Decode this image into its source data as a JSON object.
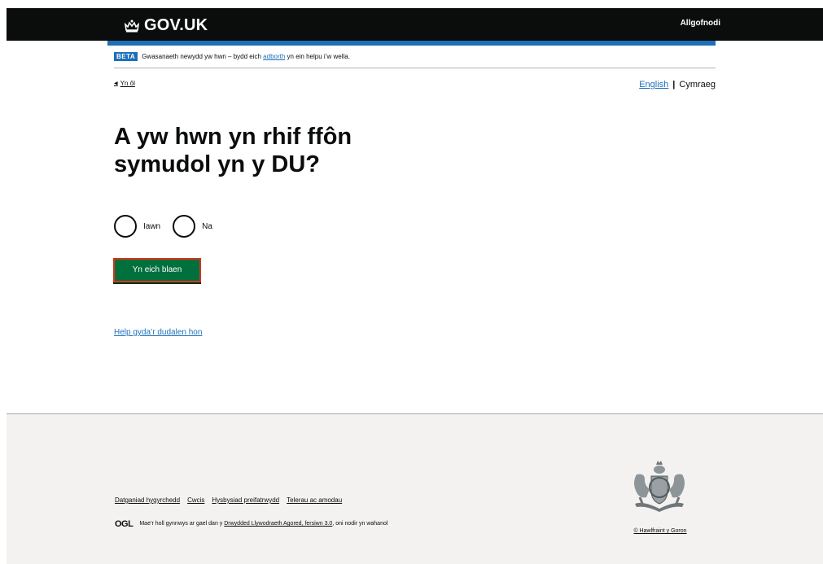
{
  "header": {
    "logo_text": "GOV.UK",
    "signout_label": "Allgofnodi"
  },
  "phase_banner": {
    "tag": "BETA",
    "text_before": "Gwasanaeth newydd yw hwn – bydd eich ",
    "link": "adborth",
    "text_after": " yn ein helpu i’w wella."
  },
  "back_link": "Yn ôl",
  "language": {
    "english": "English",
    "separator": "|",
    "current": "Cymraeg"
  },
  "question": "A yw hwn yn rhif ffôn symudol yn y DU?",
  "radios": [
    {
      "label": "Iawn"
    },
    {
      "label": "Na"
    }
  ],
  "continue_button": "Yn eich blaen",
  "help_link": "Help gyda’r dudalen hon",
  "footer": {
    "links": [
      "Datganiad hygyrchedd",
      "Cwcis",
      "Hysbysiad preifatrwydd",
      "Telerau ac amodau"
    ],
    "ogl_logo": "OGL",
    "ogl_before": "Mae’r holl gynnwys ar gael dan y ",
    "ogl_link": "Drwydded Llywodraeth Agored, fersiwn 3.0",
    "ogl_after": ", oni nodir yn wahanol",
    "copyright": "© Hawlfraint y Goron"
  },
  "colors": {
    "header_bg": "#0b0c0c",
    "brand_blue": "#1d70b8",
    "button_green": "#00703c",
    "button_border": "#d4351c",
    "footer_bg": "#f3f2f1"
  }
}
